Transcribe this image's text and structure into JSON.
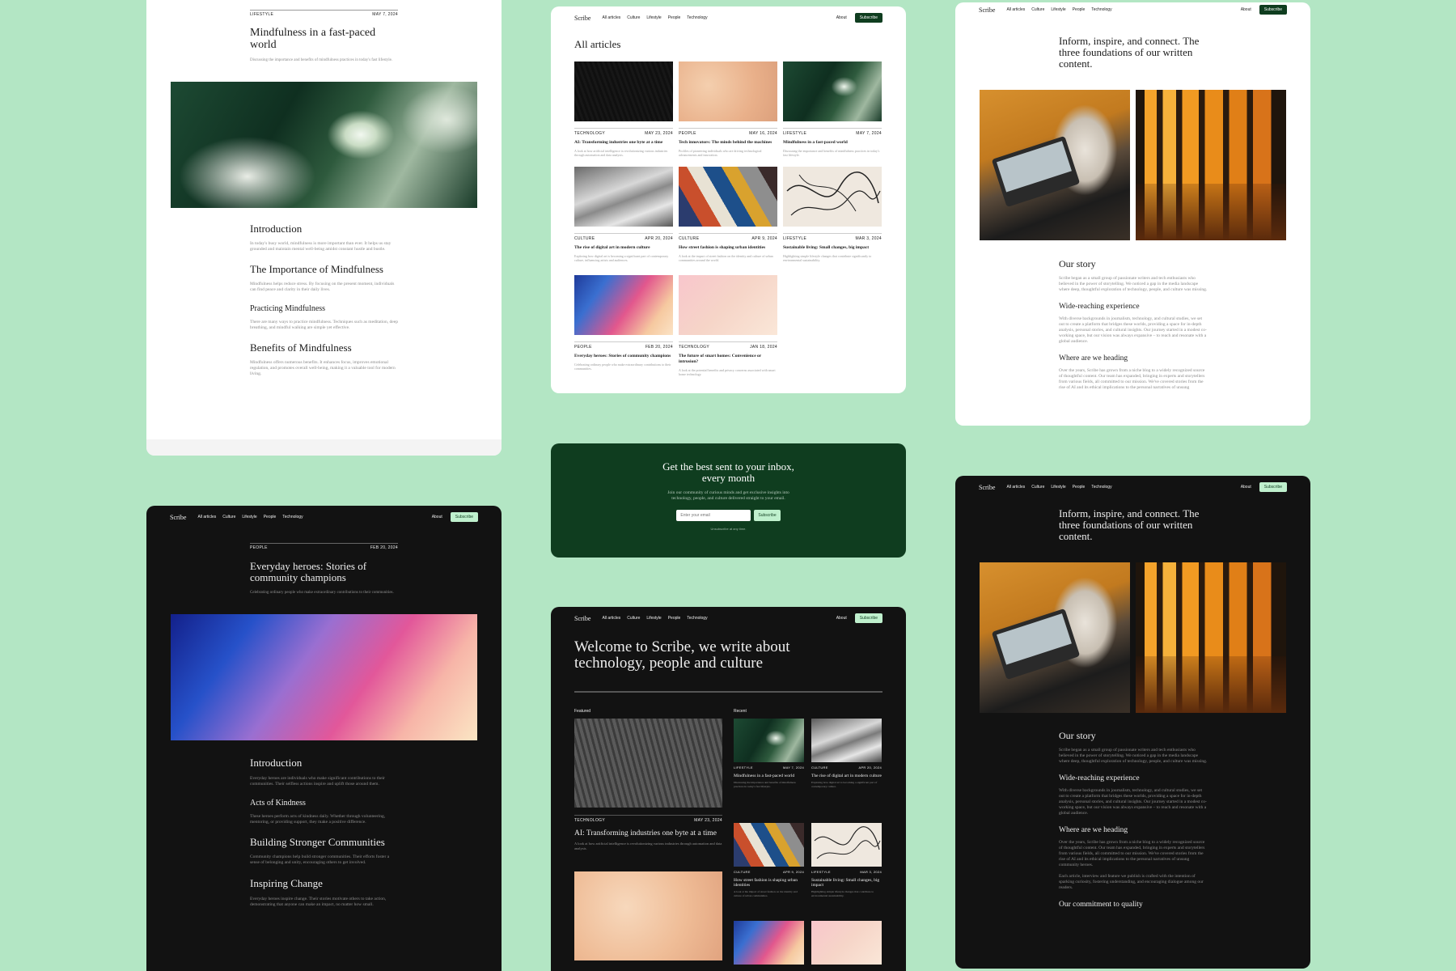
{
  "brand": "Scribe",
  "nav": {
    "links": [
      "All articles",
      "Culture",
      "Lifestyle",
      "People",
      "Technology"
    ],
    "about": "About",
    "subscribe": "Subscribe"
  },
  "card1": {
    "category": "LIFESTYLE",
    "date": "MAY 7, 2024",
    "title": "Mindfulness in a fast-paced world",
    "lede": "Discussing the importance and benefits of mindfulness practices in today's fast lifestyle.",
    "s1_h": "Introduction",
    "s1_p": "In today's busy world, mindfulness is more important than ever. It helps us stay grounded and maintain mental well-being amidst constant hustle and bustle.",
    "s2_h": "The Importance of Mindfulness",
    "s2_p": "Mindfulness helps reduce stress. By focusing on the present moment, individuals can find peace and clarity in their daily lives.",
    "s3_h": "Practicing Mindfulness",
    "s3_p": "There are many ways to practice mindfulness. Techniques such as meditation, deep breathing, and mindful walking are simple yet effective.",
    "s4_h": "Benefits of Mindfulness",
    "s4_p": "Mindfulness offers numerous benefits. It enhances focus, improves emotional regulation, and promotes overall well-being, making it a valuable tool for modern living."
  },
  "card2": {
    "heading": "All articles",
    "tiles": [
      {
        "cat": "TECHNOLOGY",
        "date": "MAY 23, 2024",
        "title": "AI: Transforming industries one byte at a time",
        "excerpt": "A look at how artificial intelligence is revolutionizing various industries through automation and data analysis."
      },
      {
        "cat": "PEOPLE",
        "date": "MAY 16, 2024",
        "title": "Tech innovators: The minds behind the machines",
        "excerpt": "Profiles of pioneering individuals who are driving technological advancements and innovation."
      },
      {
        "cat": "LIFESTYLE",
        "date": "MAY 7, 2024",
        "title": "Mindfulness in a fast-paced world",
        "excerpt": "Discussing the importance and benefits of mindfulness practices in today's fast lifestyle."
      },
      {
        "cat": "CULTURE",
        "date": "APR 20, 2024",
        "title": "The rise of digital art in modern culture",
        "excerpt": "Exploring how digital art is becoming a significant part of contemporary culture, influencing artists and audiences."
      },
      {
        "cat": "CULTURE",
        "date": "APR 9, 2024",
        "title": "How street fashion is shaping urban identities",
        "excerpt": "A look at the impact of street fashion on the identity and culture of urban communities around the world."
      },
      {
        "cat": "LIFESTYLE",
        "date": "MAR 3, 2024",
        "title": "Sustainable living: Small changes, big impact",
        "excerpt": "Highlighting simple lifestyle changes that contribute significantly to environmental sustainability."
      },
      {
        "cat": "PEOPLE",
        "date": "FEB 20, 2024",
        "title": "Everyday heroes: Stories of community champions",
        "excerpt": "Celebrating ordinary people who make extraordinary contributions to their communities."
      },
      {
        "cat": "TECHNOLOGY",
        "date": "JAN 18, 2024",
        "title": "The future of smart homes: Convenience or intrusion?",
        "excerpt": "A look at the potential benefits and privacy concerns associated with smart home technology."
      }
    ]
  },
  "card3": {
    "headline": "Inform, inspire, and connect. The three foundations of our written content.",
    "story_h": "Our story",
    "story_p": "Scribe began as a small group of passionate writers and tech enthusiasts who believed in the power of storytelling. We noticed a gap in the media landscape where deep, thoughtful exploration of technology, people, and culture was missing.",
    "exp_h": "Wide-reaching experience",
    "exp_p": "With diverse backgrounds in journalism, technology, and cultural studies, we set out to create a platform that bridges these worlds, providing a space for in-depth analysis, personal stories, and cultural insights. Our journey started in a modest co-working space, but our vision was always expansive – to reach and resonate with a global audience.",
    "head_h": "Where are we heading",
    "head_p": "Over the years, Scribe has grown from a niche blog to a widely recognized source of thoughtful content. Our team has expanded, bringing in experts and storytellers from various fields, all committed to our mission. We've covered stories from the rise of AI and its ethical implications to the personal narratives of unsung community heroes.",
    "head_p2": "Each article, interview and feature we publish is crafted with the intention of sparking curiosity, fostering understanding, and encouraging dialogue among our readers.",
    "commit_h": "Our commitment to quality"
  },
  "newsletter": {
    "title": "Get the best sent to your inbox, every month",
    "desc": "Join our community of curious minds and get exclusive insights into technology, people, and culture delivered straight to your email.",
    "placeholder": "Enter your email",
    "button": "Subscribe",
    "fine": "Unsubscribe at any time."
  },
  "card5": {
    "category": "PEOPLE",
    "date": "FEB 20, 2024",
    "title": "Everyday heroes: Stories of community champions",
    "lede": "Celebrating ordinary people who make extraordinary contributions to their communities.",
    "s1_h": "Introduction",
    "s1_p": "Everyday heroes are individuals who make significant contributions to their communities. Their selfless actions inspire and uplift those around them.",
    "s2_h": "Acts of Kindness",
    "s2_p": "These heroes perform acts of kindness daily. Whether through volunteering, mentoring, or providing support, they make a positive difference.",
    "s3_h": "Building Stronger Communities",
    "s3_p": "Community champions help build stronger communities. Their efforts foster a sense of belonging and unity, encouraging others to get involved.",
    "s4_h": "Inspiring Change",
    "s4_p": "Everyday heroes inspire change. Their stories motivate others to take action, demonstrating that anyone can make an impact, no matter how small."
  },
  "card6": {
    "headline": "Welcome to Scribe, we write about technology, people and culture",
    "featured": "Featured",
    "recent": "Recent",
    "feat_cat": "TECHNOLOGY",
    "feat_date": "MAY 23, 2024",
    "feat_title": "AI: Transforming industries one byte at a time",
    "feat_exc": "A look at how artificial intelligence is revolutionizing various industries through automation and data analysis.",
    "recent_items": [
      {
        "cat": "LIFESTYLE",
        "date": "MAY 7, 2024",
        "title": "Mindfulness in a fast-paced world",
        "excerpt": "Discussing the importance and benefits of mindfulness practices in today's fast lifestyle."
      },
      {
        "cat": "CULTURE",
        "date": "APR 20, 2024",
        "title": "The rise of digital art in modern culture",
        "excerpt": "Exploring how digital art is becoming a significant part of contemporary culture."
      },
      {
        "cat": "CULTURE",
        "date": "APR 9, 2024",
        "title": "How street fashion is shaping urban identities",
        "excerpt": "A look at the impact of street fashion on the identity and culture of urban communities."
      },
      {
        "cat": "LIFESTYLE",
        "date": "MAR 3, 2024",
        "title": "Sustainable living: Small changes, big impact",
        "excerpt": "Highlighting simple lifestyle changes that contribute to environmental sustainability."
      }
    ]
  }
}
